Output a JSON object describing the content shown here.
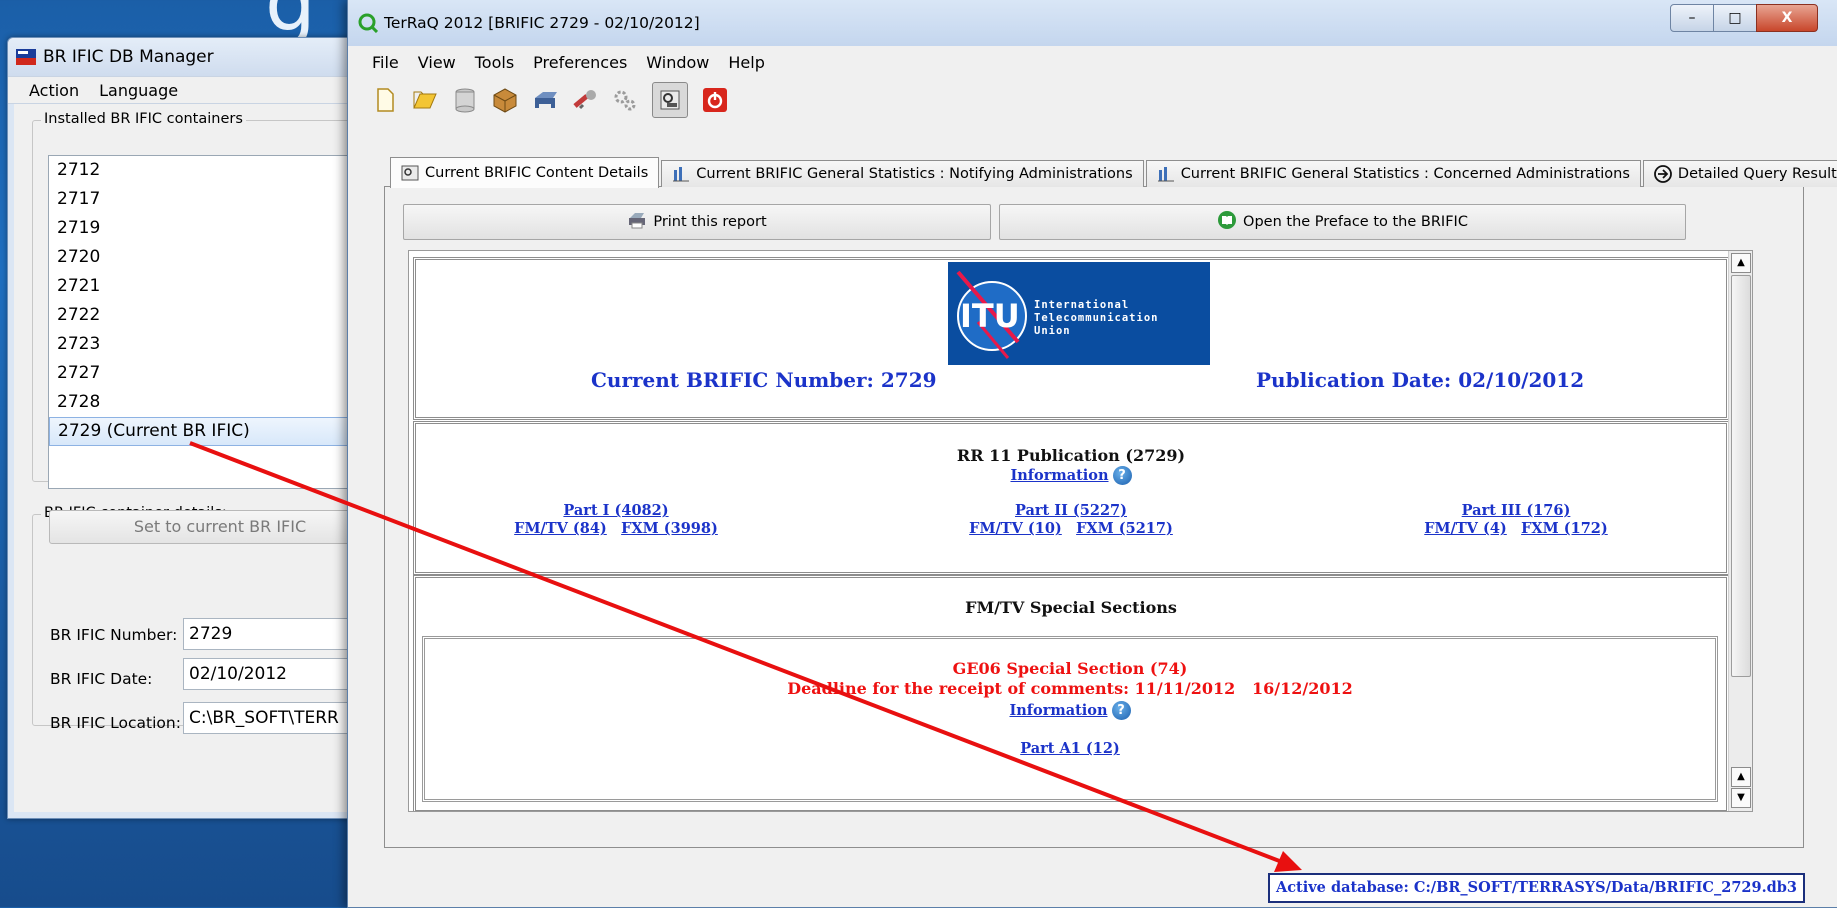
{
  "dbmanager": {
    "title": "BR IFIC DB Manager",
    "menu": [
      "Action",
      "Language"
    ],
    "installed_group_label": "Installed BR IFIC containers",
    "containers": [
      "2712",
      "2717",
      "2719",
      "2720",
      "2721",
      "2722",
      "2723",
      "2727",
      "2728",
      "2729 (Current BR IFIC)"
    ],
    "selected_index": 9,
    "set_current_label": "Set to current BR IFIC",
    "details_group_label": "BR IFIC container details:",
    "number_label": "BR IFIC Number:",
    "number_value": "2729",
    "date_label": "BR IFIC Date:",
    "date_value": "02/10/2012",
    "location_label": "BR IFIC Location:",
    "location_value": "C:\\BR_SOFT\\TERR"
  },
  "terraq": {
    "title": "TerRaQ 2012 [BRIFIC 2729 - 02/10/2012]",
    "window_buttons": [
      "–",
      "□",
      "X"
    ],
    "menu": [
      "File",
      "View",
      "Tools",
      "Preferences",
      "Window",
      "Help"
    ],
    "toolbar_icons": [
      "new-file-icon",
      "open-folder-icon",
      "database-icon",
      "package-icon",
      "printer-icon",
      "tools-icon",
      "settings-gears-icon",
      "query-icon",
      "power-icon"
    ],
    "tabs": [
      "Current BRIFIC Content Details",
      "Current BRIFIC General Statistics : Notifying Administrations",
      "Current BRIFIC General Statistics : Concerned Administrations",
      "Detailed Query Results"
    ],
    "active_tab": 0,
    "print_button": "Print this report",
    "preface_button": "Open the Preface to the BRIFIC",
    "report": {
      "logo_lines": [
        "International",
        "Telecommunication",
        "Union"
      ],
      "logo_letters": "ITU",
      "brific_number": "Current BRIFIC Number: 2729",
      "publication_date": "Publication Date: 02/10/2012",
      "rr11_title": "RR 11 Publication (2729)",
      "information_link": "Information",
      "parts": [
        {
          "title": "Part I (4082)",
          "fmtv": "FM/TV (84)",
          "fxm": "FXM (3998)"
        },
        {
          "title": "Part II (5227)",
          "fmtv": "FM/TV (10)",
          "fxm": "FXM (5217)"
        },
        {
          "title": "Part III (176)",
          "fmtv": "FM/TV (4)",
          "fxm": "FXM (172)"
        }
      ],
      "special_title": "FM/TV Special Sections",
      "ge06_title": "GE06 Special Section (74)",
      "deadline": "Deadline for the receipt of comments: 11/11/2012   16/12/2012",
      "ge06_information": "Information",
      "part_a1": "Part A1 (12)"
    },
    "status": "Active database: C:/BR_SOFT/TERRASYS/Data/BRIFIC_2729.db3"
  },
  "colors": {
    "link_blue": "#1b33c9",
    "red_text": "#ee1111",
    "annotation_arrow": "#e81010",
    "itu_blue": "#0a4da0"
  }
}
